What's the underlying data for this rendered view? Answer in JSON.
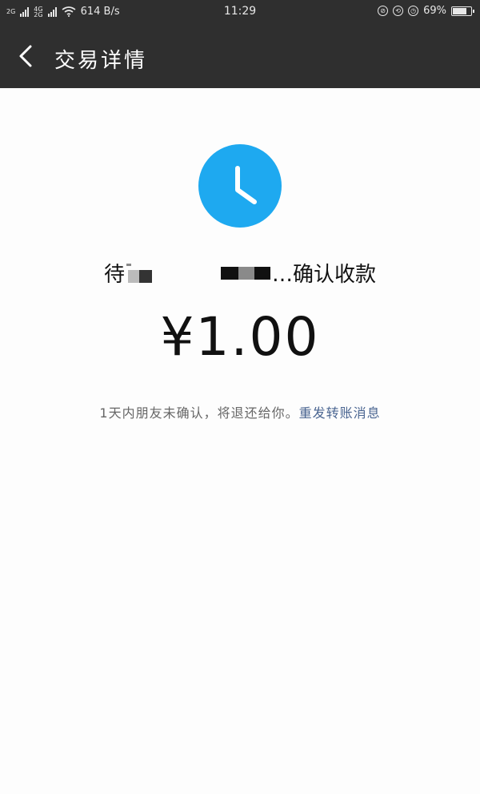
{
  "status_bar": {
    "net_2g": "2G",
    "net_4g": "4G",
    "net_2g_b": "2G",
    "speed": "614 B/s",
    "time": "11:29",
    "battery": "69%",
    "battery_level": 0.69
  },
  "nav": {
    "title": "交易详情"
  },
  "transfer": {
    "status_prefix": "待",
    "status_suffix": "…确认收款",
    "amount": "¥1.00",
    "info_text": "1天内朋友未确认，将退还给你。",
    "resend_link": "重发转账消息"
  },
  "colors": {
    "header_bg": "#2f2f2f",
    "clock_blue": "#1ea9f0",
    "link_blue": "#4a6591"
  },
  "icons": {
    "back": "chevron-left-icon",
    "clock": "clock-icon"
  }
}
